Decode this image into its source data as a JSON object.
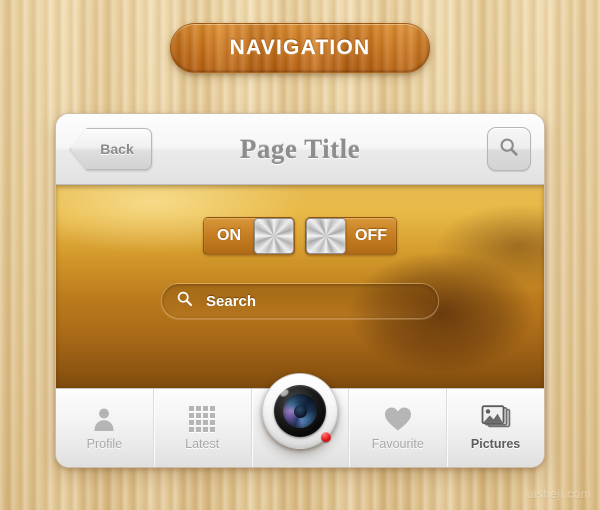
{
  "banner": {
    "title": "NAVIGATION"
  },
  "header": {
    "back_label": "Back",
    "page_title": "Page Title",
    "search_icon": "search-icon"
  },
  "content": {
    "toggles": [
      {
        "label": "ON",
        "state": "on"
      },
      {
        "label": "OFF",
        "state": "off"
      }
    ],
    "search": {
      "placeholder": "Search",
      "icon": "search-icon"
    }
  },
  "tabbar": {
    "items": [
      {
        "label": "Profile",
        "icon": "person-icon",
        "active": false
      },
      {
        "label": "Latest",
        "icon": "grid-icon",
        "active": false
      },
      {
        "label": "Favourite",
        "icon": "heart-icon",
        "active": false
      },
      {
        "label": "Pictures",
        "icon": "photos-icon",
        "active": true
      }
    ]
  },
  "camera": {
    "name": "camera-shutter-button",
    "led_color": "#e31616"
  },
  "watermark": {
    "text": "uisheji.com"
  },
  "colors": {
    "banner_orange": "#c9741b",
    "wood_background": "#e6cd99",
    "content_gold": "#bc7c1d",
    "tab_label": "#a9a9a9",
    "tab_label_active": "#5e5e5e",
    "title_gray": "#8d8d8d"
  }
}
